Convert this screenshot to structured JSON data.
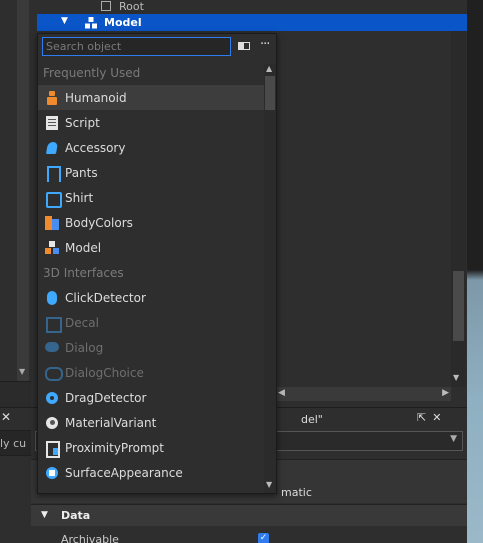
{
  "explorer": {
    "root_label": "Root",
    "selected_label": "Model"
  },
  "search": {
    "placeholder": "Search object",
    "value": ""
  },
  "menu": {
    "categories": [
      {
        "label": "Frequently Used"
      },
      {
        "label": "3D Interfaces"
      }
    ],
    "items": [
      {
        "label": "Humanoid",
        "icon": "humanoid-icon",
        "enabled": true
      },
      {
        "label": "Script",
        "icon": "script-icon",
        "enabled": true
      },
      {
        "label": "Accessory",
        "icon": "accessory-icon",
        "enabled": true
      },
      {
        "label": "Pants",
        "icon": "pants-icon",
        "enabled": true
      },
      {
        "label": "Shirt",
        "icon": "shirt-icon",
        "enabled": true
      },
      {
        "label": "BodyColors",
        "icon": "bodycolors-icon",
        "enabled": true
      },
      {
        "label": "Model",
        "icon": "model-icon",
        "enabled": true
      },
      {
        "label": "ClickDetector",
        "icon": "clickdetector-icon",
        "enabled": true
      },
      {
        "label": "Decal",
        "icon": "decal-icon",
        "enabled": false
      },
      {
        "label": "Dialog",
        "icon": "dialog-icon",
        "enabled": false
      },
      {
        "label": "DialogChoice",
        "icon": "dialogchoice-icon",
        "enabled": false
      },
      {
        "label": "DragDetector",
        "icon": "dragdetector-icon",
        "enabled": true
      },
      {
        "label": "MaterialVariant",
        "icon": "materialvariant-icon",
        "enabled": true
      },
      {
        "label": "ProximityPrompt",
        "icon": "proximityprompt-icon",
        "enabled": true
      },
      {
        "label": "SurfaceAppearance",
        "icon": "surfaceappearance-icon",
        "enabled": true
      }
    ]
  },
  "properties": {
    "title_fragment": "del\"",
    "value_fragment": "matic",
    "section_label": "Data",
    "row_label": "Archivable",
    "archivable_checked": true
  },
  "left_panel": {
    "text_fragment": "ly cu"
  },
  "colors": {
    "selection": "#0a55c8",
    "accent": "#2f7cf0",
    "icon_blue": "#3fa9ff",
    "icon_orange": "#f08a2e"
  }
}
